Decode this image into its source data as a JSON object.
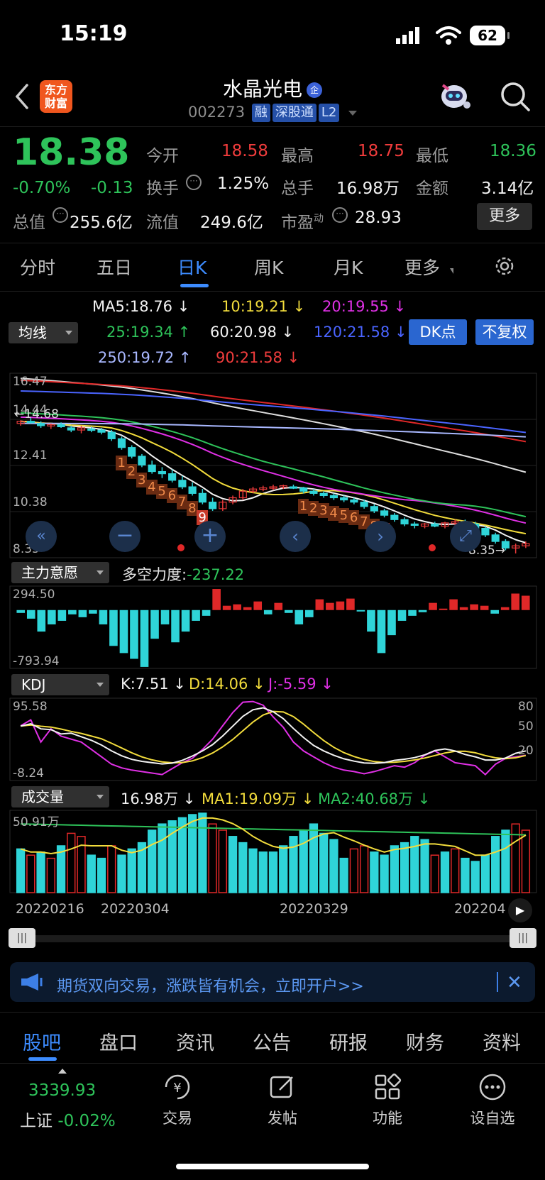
{
  "status": {
    "time": "15:19",
    "battery": "62"
  },
  "header": {
    "logo": "东方\n财富",
    "name": "水晶光电",
    "badge": "企",
    "code": "002273",
    "tags": [
      "融",
      "深股通",
      "L2"
    ]
  },
  "quote": {
    "price": "18.38",
    "change_pct": "-0.70%",
    "change": "-0.13",
    "open_label": "今开",
    "open": "18.58",
    "high_label": "最高",
    "high": "18.75",
    "low_label": "最低",
    "low": "18.36",
    "turnover_label": "换手",
    "turnover": "1.25%",
    "volume_label": "总手",
    "volume": "16.98万",
    "amount_label": "金额",
    "amount": "3.14亿",
    "mktcap_label": "总值",
    "mktcap": "255.6亿",
    "float_label": "流值",
    "float": "249.6亿",
    "pe_label": "市盈",
    "pe_sup": "动",
    "pe": "28.93",
    "more": "更多"
  },
  "ktabs": [
    "分时",
    "五日",
    "日K",
    "周K",
    "月K",
    "更多"
  ],
  "ma": {
    "selector": "均线",
    "ma5": "MA5:18.76",
    "ma10": "10:19.21",
    "ma20": "20:19.55",
    "ma25": "25:19.34",
    "ma60": "60:20.98",
    "ma120": "120:21.58",
    "ma250": "250:19.72",
    "ma90": "90:21.58",
    "dk": "DK点",
    "fq": "不复权"
  },
  "price_axis": {
    "top": "16.47",
    "l1": "14.44",
    "l2": "12.41",
    "l3": "10.38",
    "bottom": "8.35",
    "hl_high": "14.68",
    "hl_low": "8.35"
  },
  "td_seq1": [
    "1",
    "2",
    "3",
    "4",
    "5",
    "6",
    "7",
    "8",
    "9"
  ],
  "td_seq2": [
    "1",
    "2",
    "3",
    "4",
    "5",
    "6",
    "7",
    "8",
    "9"
  ],
  "mf": {
    "selector": "主力意愿",
    "label": "多空力度:",
    "value": "-237.22",
    "top": "294.50",
    "bottom": "-793.94"
  },
  "kdj": {
    "selector": "KDJ",
    "k": "K:7.51",
    "d": "D:14.06",
    "j": "J:-5.59",
    "top": "95.58",
    "bottom": "-8.24",
    "r80": "80",
    "r50": "50",
    "r20": "20"
  },
  "vol": {
    "selector": "成交量",
    "v": "16.98万",
    "ma1": "MA1:19.09万",
    "ma2": "MA2:40.68万",
    "top": "50.91万"
  },
  "dates": [
    "20220216",
    "20220304",
    "20220329",
    "202204"
  ],
  "banner": {
    "text": "期货双向交易，涨跌皆有机会，立即开户>>"
  },
  "btabs": [
    "股吧",
    "盘口",
    "资讯",
    "公告",
    "研报",
    "财务",
    "资料"
  ],
  "dock": {
    "index_value": "3339.93",
    "index_name": "上证",
    "index_pct": "-0.02%",
    "items": [
      "交易",
      "发帖",
      "功能",
      "设自选"
    ]
  },
  "chart_data": {
    "type": "candlestick",
    "price_range": [
      8.35,
      16.47
    ],
    "candles": [
      [
        14.3,
        14.45,
        14.2,
        14.4
      ],
      [
        14.4,
        14.55,
        14.3,
        14.35
      ],
      [
        14.3,
        14.4,
        14.1,
        14.2
      ],
      [
        14.2,
        14.3,
        14.05,
        14.25
      ],
      [
        14.25,
        14.35,
        14.1,
        14.15
      ],
      [
        14.1,
        14.2,
        13.9,
        14.0
      ],
      [
        14.0,
        14.2,
        13.85,
        14.1
      ],
      [
        14.05,
        14.15,
        13.9,
        14.0
      ],
      [
        14.0,
        14.1,
        13.8,
        13.9
      ],
      [
        13.9,
        14.0,
        13.5,
        13.6
      ],
      [
        13.6,
        13.7,
        13.1,
        13.2
      ],
      [
        13.2,
        13.3,
        12.7,
        12.8
      ],
      [
        12.8,
        12.9,
        12.3,
        12.4
      ],
      [
        12.4,
        12.6,
        12.0,
        12.1
      ],
      [
        12.1,
        12.3,
        11.8,
        12.0
      ],
      [
        12.0,
        12.2,
        11.6,
        11.7
      ],
      [
        11.7,
        11.9,
        11.3,
        11.4
      ],
      [
        11.4,
        11.6,
        11.0,
        11.1
      ],
      [
        11.1,
        11.3,
        10.6,
        10.7
      ],
      [
        10.7,
        10.9,
        10.3,
        10.4
      ],
      [
        10.4,
        10.8,
        10.3,
        10.7
      ],
      [
        10.7,
        11.0,
        10.6,
        10.9
      ],
      [
        10.9,
        11.3,
        10.8,
        11.2
      ],
      [
        11.2,
        11.4,
        11.1,
        11.3
      ],
      [
        11.3,
        11.45,
        11.2,
        11.35
      ],
      [
        11.35,
        11.5,
        11.25,
        11.4
      ],
      [
        11.4,
        11.5,
        11.3,
        11.45
      ],
      [
        11.4,
        11.5,
        11.3,
        11.35
      ],
      [
        11.35,
        11.4,
        11.1,
        11.2
      ],
      [
        11.2,
        11.3,
        11.0,
        11.1
      ],
      [
        11.1,
        11.2,
        10.9,
        11.0
      ],
      [
        11.0,
        11.1,
        10.8,
        10.9
      ],
      [
        10.9,
        11.0,
        10.7,
        10.8
      ],
      [
        10.8,
        10.9,
        10.6,
        10.7
      ],
      [
        10.7,
        10.8,
        10.4,
        10.5
      ],
      [
        10.5,
        10.6,
        10.2,
        10.3
      ],
      [
        10.3,
        10.4,
        10.0,
        10.1
      ],
      [
        10.1,
        10.2,
        9.8,
        9.9
      ],
      [
        9.9,
        10.0,
        9.6,
        9.7
      ],
      [
        9.7,
        9.8,
        9.5,
        9.65
      ],
      [
        9.6,
        9.75,
        9.5,
        9.7
      ],
      [
        9.7,
        9.8,
        9.55,
        9.6
      ],
      [
        9.6,
        9.8,
        9.5,
        9.75
      ],
      [
        9.75,
        9.9,
        9.6,
        9.8
      ],
      [
        9.8,
        9.9,
        9.6,
        9.7
      ],
      [
        9.7,
        9.8,
        9.4,
        9.5
      ],
      [
        9.5,
        9.6,
        9.1,
        9.2
      ],
      [
        9.2,
        9.3,
        8.8,
        8.9
      ],
      [
        8.9,
        9.0,
        8.5,
        8.6
      ],
      [
        8.6,
        8.8,
        8.35,
        8.7
      ],
      [
        8.7,
        8.9,
        8.6,
        8.8
      ]
    ],
    "mf_values": [
      -40,
      -120,
      -300,
      -200,
      -150,
      -60,
      -100,
      -50,
      -200,
      -500,
      -600,
      -680,
      -793,
      -400,
      -200,
      -450,
      -300,
      -150,
      -80,
      294,
      60,
      80,
      40,
      120,
      -60,
      100,
      -40,
      -200,
      -100,
      150,
      100,
      120,
      160,
      -20,
      -300,
      -600,
      -350,
      -150,
      -80,
      -30,
      100,
      20,
      150,
      40,
      80,
      60,
      -50,
      40,
      230,
      200
    ],
    "vol_values": [
      28,
      24,
      26,
      22,
      30,
      38,
      36,
      24,
      22,
      30,
      24,
      28,
      32,
      40,
      44,
      46,
      48,
      50,
      50.91,
      44,
      40,
      36,
      32,
      28,
      26,
      26,
      30,
      36,
      40,
      44,
      38,
      34,
      22,
      28,
      30,
      26,
      24,
      30,
      32,
      36,
      34,
      24,
      26,
      28,
      22,
      20,
      24,
      36,
      40,
      44,
      40
    ],
    "vol_up": [
      0,
      1,
      0,
      1,
      0,
      1,
      1,
      0,
      0,
      1,
      0,
      0,
      0,
      0,
      0,
      0,
      0,
      0,
      0,
      1,
      1,
      0,
      0,
      0,
      0,
      0,
      0,
      0,
      0,
      0,
      0,
      0,
      0,
      1,
      1,
      0,
      0,
      0,
      0,
      0,
      0,
      1,
      0,
      1,
      0,
      0,
      0,
      0,
      0,
      1,
      1
    ]
  }
}
